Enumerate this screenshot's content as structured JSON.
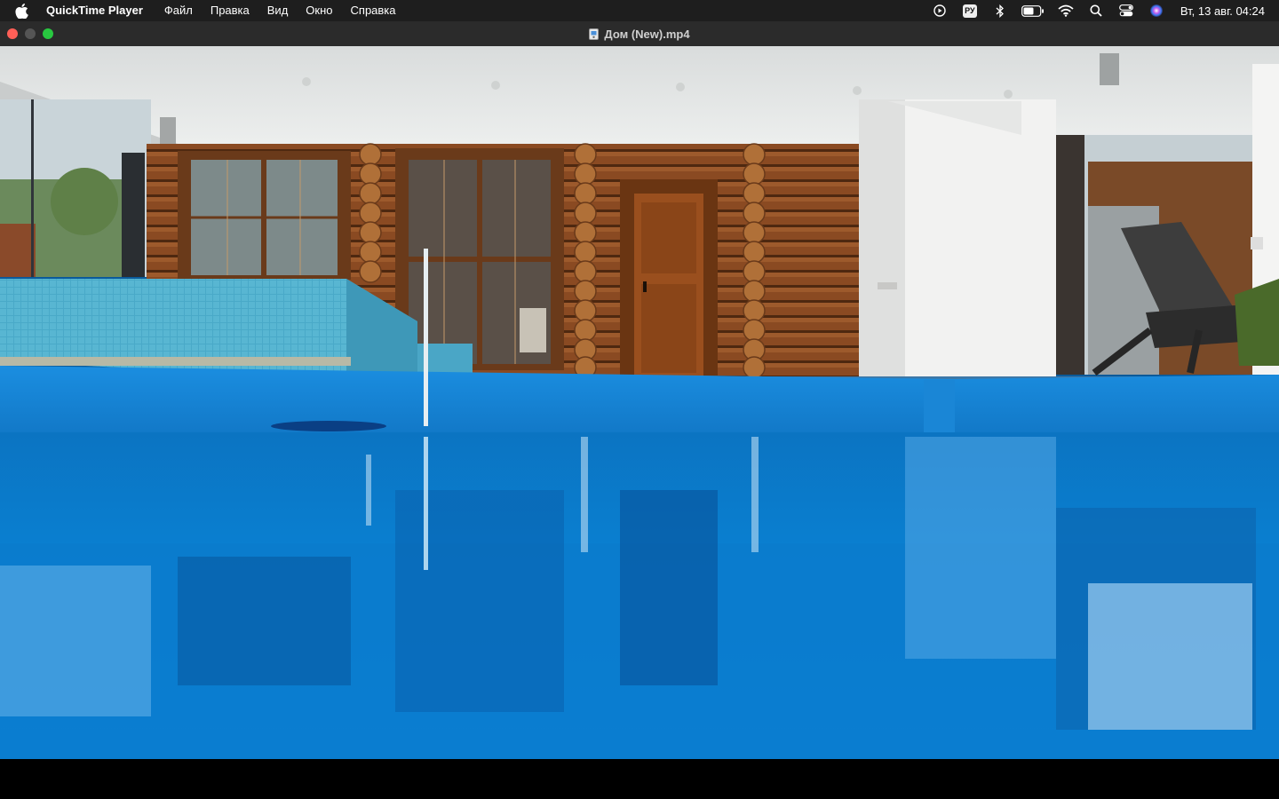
{
  "menubar": {
    "app_name": "QuickTime Player",
    "menus": [
      "Файл",
      "Правка",
      "Вид",
      "Окно",
      "Справка"
    ],
    "input_source": "РУ",
    "datetime": "Вт, 13 авг.  04:24",
    "icons": [
      "apple-icon",
      "screen-record-icon",
      "input-source-icon",
      "bluetooth-icon",
      "battery-icon",
      "wifi-icon",
      "spotlight-icon",
      "control-center-icon",
      "siri-icon"
    ]
  },
  "window": {
    "title": "Дом (New).mp4",
    "buttons": [
      "close",
      "minimize",
      "zoom"
    ]
  },
  "video": {
    "scene": "indoor-pool-log-house"
  },
  "colors": {
    "menubar_bg": "#1e1e1e",
    "titlebar_bg": "#2b2b2b",
    "pool_blue": "#0a86d6",
    "wood": "#8a4a22"
  }
}
